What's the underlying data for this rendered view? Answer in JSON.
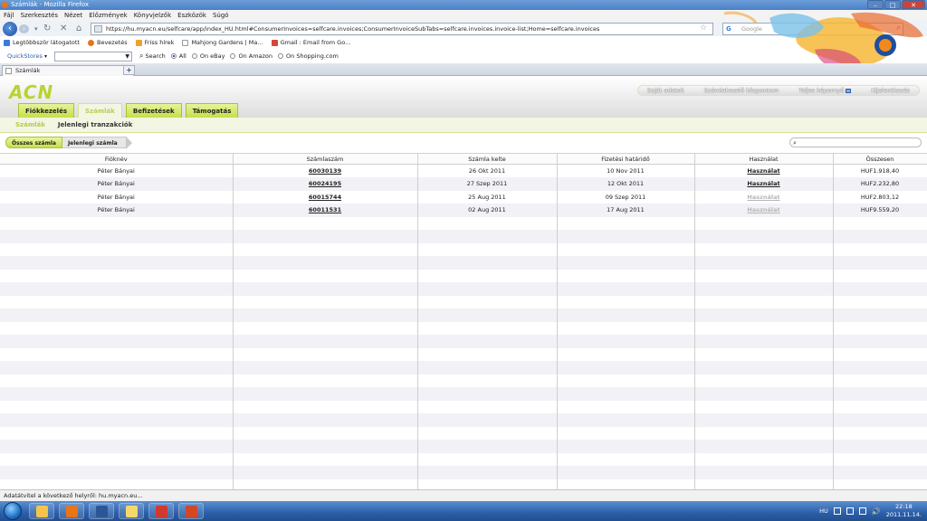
{
  "window": {
    "title": "Számlák - Mozilla Firefox"
  },
  "menu": [
    "Fájl",
    "Szerkesztés",
    "Nézet",
    "Előzmények",
    "Könyvjelzők",
    "Eszközök",
    "Súgó"
  ],
  "nav": {
    "url": "https://hu.myacn.eu/selfcare/app/index_HU.html#ConsumerInvoices=selfcare.invoices;ConsumerInvoiceSubTabs=selfcare.invoices.invoice-list;Home=selfcare.invoices",
    "search_placeholder": "Google"
  },
  "bookmarks": [
    {
      "label": "Legtöbbször látogatott",
      "color": "#3a7ae0"
    },
    {
      "label": "Bevezetés",
      "color": "#e8751a"
    },
    {
      "label": "Friss hírek",
      "color": "#f0a030"
    },
    {
      "label": "Mahjong Gardens | Ma...",
      "color": "#ffffff"
    },
    {
      "label": "Gmail : Email from Go...",
      "color": "#d44638"
    }
  ],
  "quickstores": {
    "label": "QuickStores",
    "search_label": "Search",
    "options": [
      "All",
      "On eBay",
      "On Amazon",
      "On Shopping.com"
    ]
  },
  "tab": {
    "label": "Számlák"
  },
  "site": {
    "logo": "ACN",
    "top_links": [
      "Saját adatok",
      "Számlakezelő központom",
      "Teljes képernyő",
      "Kijelentkezés"
    ],
    "main_tabs": [
      "Fiókkezelés",
      "Számlák",
      "Befizetések",
      "Támogatás"
    ],
    "active_tab": "Számlák",
    "sub_tabs": [
      "Számlák",
      "Jelenlegi tranzakciók"
    ],
    "filters": [
      "Összes számla",
      "Jelenlegi számla"
    ]
  },
  "table": {
    "columns": [
      "Fióknév",
      "Számlaszám",
      "Számla kelte",
      "Fizetési határidő",
      "Használat",
      "Összesen"
    ],
    "rows": [
      {
        "name": "Péter Bányai",
        "number": "60030139",
        "date": "26 Okt 2011",
        "due": "10 Nov 2011",
        "usage": "Használat",
        "usage_active": true,
        "total": "HUF1.918,40"
      },
      {
        "name": "Péter Bányai",
        "number": "60024195",
        "date": "27 Szep 2011",
        "due": "12 Okt 2011",
        "usage": "Használat",
        "usage_active": true,
        "total": "HUF2.232,80"
      },
      {
        "name": "Péter Bányai",
        "number": "60015744",
        "date": "25 Aug 2011",
        "due": "09 Szep 2011",
        "usage": "Használat",
        "usage_active": false,
        "total": "HUF2.803,12"
      },
      {
        "name": "Péter Bányai",
        "number": "60011531",
        "date": "02 Aug 2011",
        "due": "17 Aug 2011",
        "usage": "Használat",
        "usage_active": false,
        "total": "HUF9.559,20"
      }
    ],
    "empty_rows": 21
  },
  "status": {
    "text": "Adatátvitel a következő helyről: hu.myacn.eu..."
  },
  "taskbar": {
    "apps": [
      {
        "name": "explorer",
        "color": "#f2c44c"
      },
      {
        "name": "firefox",
        "color": "#e8751a"
      },
      {
        "name": "word",
        "color": "#2b579a"
      },
      {
        "name": "mail",
        "color": "#f5d86a"
      },
      {
        "name": "photos",
        "color": "#d33a2c"
      },
      {
        "name": "powerpoint",
        "color": "#d24726"
      }
    ],
    "lang": "HU",
    "time": "22:18",
    "date": "2011.11.14."
  }
}
